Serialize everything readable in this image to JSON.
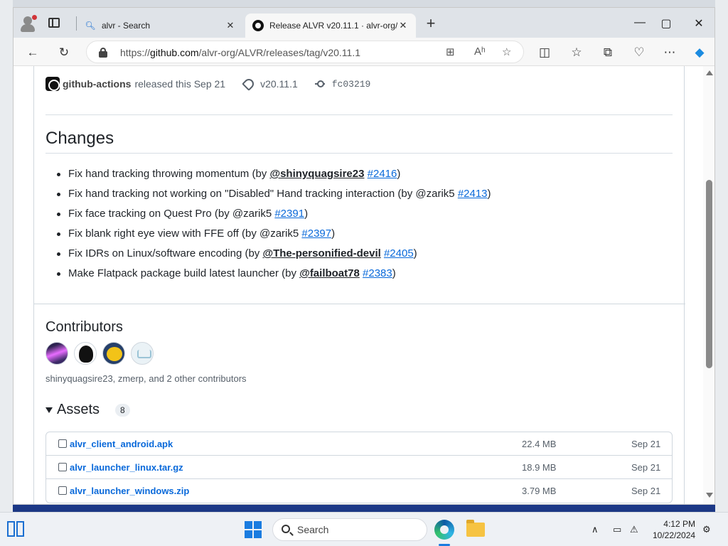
{
  "browser": {
    "tabs": [
      {
        "label": "alvr - Search",
        "icon": "search-icon",
        "active": false
      },
      {
        "label": "Release ALVR v20.11.1 · alvr-org/A",
        "icon": "github-icon",
        "active": true
      }
    ],
    "address": {
      "prefix": "https://",
      "domain": "github.com",
      "path": "/alvr-org/ALVR/releases/tag/v20.11.1"
    }
  },
  "release": {
    "actor": "github-actions",
    "released_text": "released this Sep 21",
    "tag": "v20.11.1",
    "commit": "fc03219"
  },
  "changes": {
    "heading": "Changes",
    "items": [
      {
        "pre": "Fix hand tracking throwing momentum (by ",
        "mention": "@shinyquagsire23",
        "mid": " ",
        "pr": "#2416",
        "post": ")"
      },
      {
        "pre": "Fix hand tracking not working on \"Disabled\" Hand tracking interaction (by @zarik5 ",
        "mention": "",
        "mid": "",
        "pr": "#2413",
        "post": ")"
      },
      {
        "pre": "Fix face tracking on Quest Pro (by @zarik5 ",
        "mention": "",
        "mid": "",
        "pr": "#2391",
        "post": ")"
      },
      {
        "pre": "Fix blank right eye view with FFE off (by @zarik5 ",
        "mention": "",
        "mid": "",
        "pr": "#2397",
        "post": ")"
      },
      {
        "pre": "Fix IDRs on Linux/software encoding (by ",
        "mention": "@The-personified-devil",
        "mid": " ",
        "pr": "#2405",
        "post": ")"
      },
      {
        "pre": "Make Flatpack package build latest launcher (by ",
        "mention": "@failboat78",
        "mid": " ",
        "pr": "#2383",
        "post": ")"
      }
    ]
  },
  "contributors": {
    "heading": "Contributors",
    "summary": "shinyquagsire23, zmerp, and 2 other contributors"
  },
  "assets": {
    "heading": "Assets",
    "count": "8",
    "rows": [
      {
        "name": "alvr_client_android.apk",
        "size": "22.4 MB",
        "date": "Sep 21"
      },
      {
        "name": "alvr_launcher_linux.tar.gz",
        "size": "18.9 MB",
        "date": "Sep 21"
      },
      {
        "name": "alvr_launcher_windows.zip",
        "size": "3.79 MB",
        "date": "Sep 21"
      }
    ]
  },
  "taskbar": {
    "search_label": "Search",
    "time": "4:12 PM",
    "date": "10/22/2024"
  }
}
